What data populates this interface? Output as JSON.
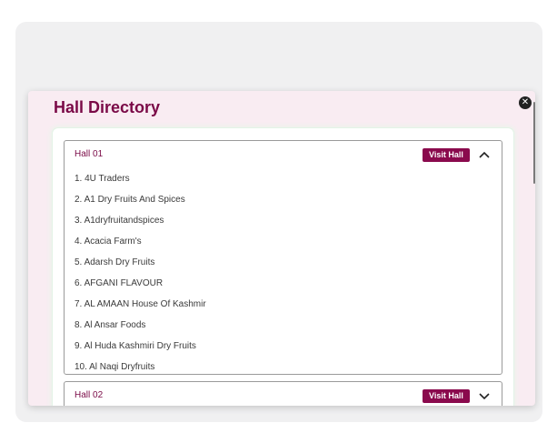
{
  "modal": {
    "title": "Hall Directory"
  },
  "halls": [
    {
      "name": "Hall 01",
      "button": "Visit Hall",
      "expanded": true,
      "exhibitors": [
        "1. 4U Traders",
        "2. A1 Dry Fruits And Spices",
        "3. A1dryfruitandspices",
        "4. Acacia Farm's",
        "5. Adarsh Dry Fruits",
        "6. AFGANI FLAVOUR",
        "7. AL AMAAN House Of Kashmir",
        "8. Al Ansar Foods",
        "9. Al Huda Kashmiri Dry Fruits",
        "10. Al Naqi Dryfruits"
      ]
    },
    {
      "name": "Hall 02",
      "button": "Visit Hall",
      "expanded": false
    }
  ],
  "icons": {
    "close": "close-icon",
    "collapse": "chevron-up-icon",
    "expand": "chevron-down-icon"
  },
  "colors": {
    "brand": "#7a0a47",
    "button": "#8a0a4d",
    "modal_bg": "#f9ecf2",
    "outer_bg": "#f0f0f1"
  }
}
